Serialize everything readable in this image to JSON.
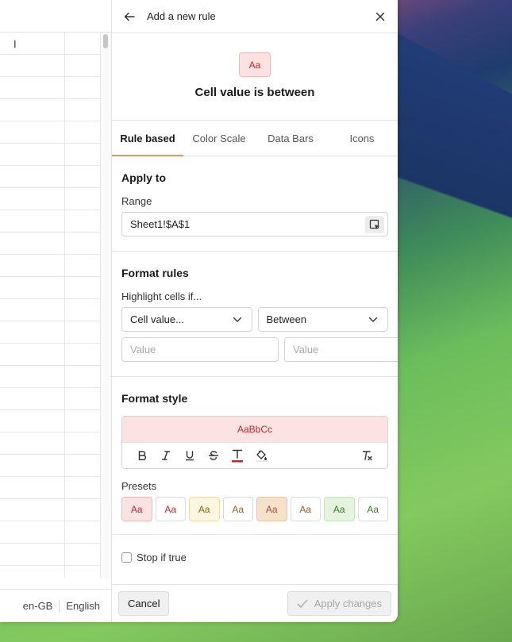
{
  "sheet": {
    "column_header": "I",
    "locale": "en-GB",
    "language": "English"
  },
  "panel": {
    "header": {
      "title": "Add a new rule",
      "back_icon": "arrow-left-icon",
      "close_icon": "close-icon"
    },
    "preview": {
      "chip_text": "Aa",
      "title": "Cell value is between"
    },
    "tabs": [
      {
        "label": "Rule based",
        "active": true
      },
      {
        "label": "Color Scale",
        "active": false
      },
      {
        "label": "Data Bars",
        "active": false
      },
      {
        "label": "Icons",
        "active": false
      }
    ],
    "apply_to": {
      "heading": "Apply to",
      "range_label": "Range",
      "range_value": "Sheet1!$A$1"
    },
    "format_rules": {
      "heading": "Format rules",
      "highlight_label": "Highlight cells if...",
      "condition_select": "Cell value...",
      "operator_select": "Between",
      "value1_placeholder": "Value",
      "value2_placeholder": "Value"
    },
    "format_style": {
      "heading": "Format style",
      "preview_text": "AaBbCc",
      "tools": [
        "bold-icon",
        "italic-icon",
        "underline-icon",
        "strikethrough-icon",
        "text-color-icon",
        "fill-color-icon",
        "clear-format-icon"
      ],
      "presets_label": "Presets",
      "presets": [
        {
          "text": "Aa",
          "bg": "#fde2e2",
          "color": "#c0292b",
          "border": "#f2b7b7"
        },
        {
          "text": "Aa",
          "bg": "#ffffff",
          "color": "#c0292b",
          "border": "#dcdcdc"
        },
        {
          "text": "Aa",
          "bg": "#fdf6e0",
          "color": "#8a6a10",
          "border": "#ecdcaa"
        },
        {
          "text": "Aa",
          "bg": "#ffffff",
          "color": "#8a6a10",
          "border": "#dcdcdc"
        },
        {
          "text": "Aa",
          "bg": "#f7e1cb",
          "color": "#a0522d",
          "border": "#e8c7a5"
        },
        {
          "text": "Aa",
          "bg": "#ffffff",
          "color": "#a0522d",
          "border": "#dcdcdc"
        },
        {
          "text": "Aa",
          "bg": "#e6f3df",
          "color": "#3a7a2a",
          "border": "#c8e0bb"
        },
        {
          "text": "Aa",
          "bg": "#ffffff",
          "color": "#3a7a2a",
          "border": "#dcdcdc"
        }
      ]
    },
    "stop_if_true": "Stop if true",
    "footer": {
      "cancel": "Cancel",
      "apply": "Apply changes"
    }
  }
}
